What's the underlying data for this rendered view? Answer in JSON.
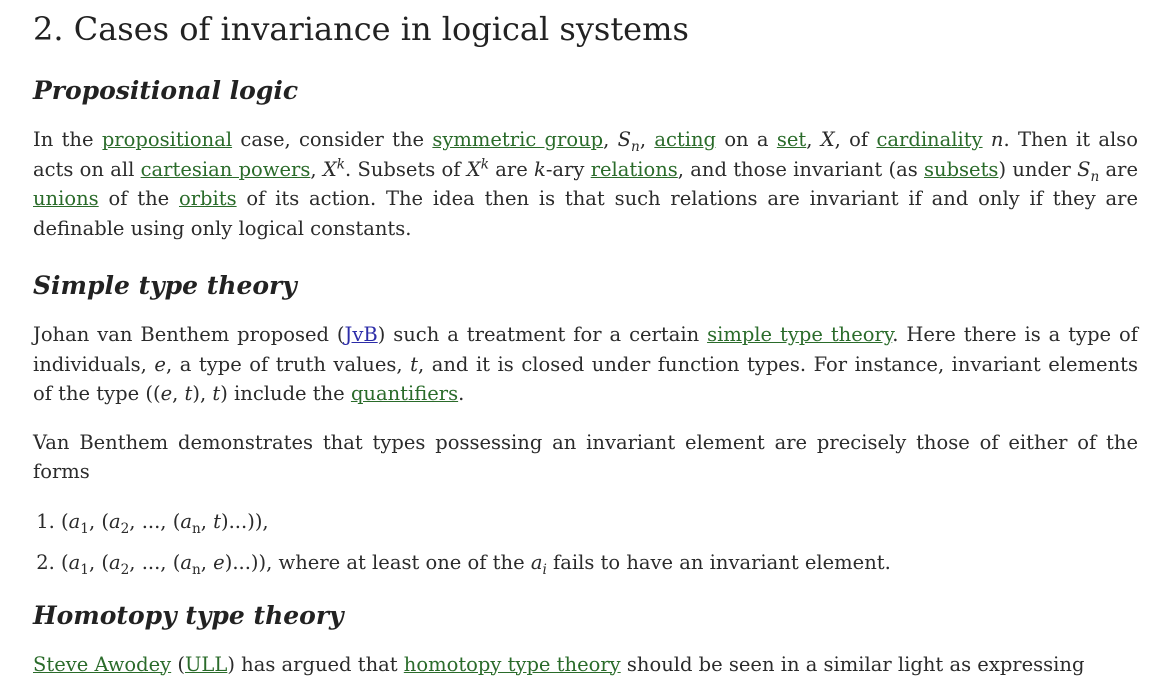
{
  "section": {
    "title": "2. Cases of invariance in logical systems"
  },
  "propositional": {
    "heading": "Propositional logic",
    "t1": "In the ",
    "l_propositional": "propositional",
    "t2": " case, consider the ",
    "l_symmetric_group": "symmetric group",
    "t3": ", ",
    "S": "S",
    "n": "n",
    "t4": ", ",
    "l_acting": "acting",
    "t5": " on a ",
    "l_set": "set",
    "t6": ", ",
    "X": "X",
    "t7": ", of ",
    "l_cardinality": "cardinality",
    "t8": " ",
    "n2": "n",
    "t9": ". Then it also acts on all ",
    "l_cartesian_powers": "cartesian powers",
    "t10": ", ",
    "k": "k",
    "t11": ". Subsets of ",
    "t12": " are ",
    "t13": "-ary ",
    "l_relations": "relations",
    "t14": ", and those invariant (as ",
    "l_subsets": "subsets",
    "t15": ") under ",
    "t16": " are ",
    "l_unions": "unions",
    "t17": " of the ",
    "l_orbits": "orbits",
    "t18": " of its action. The idea then is that such relations are invariant if and only if they are definable using only logical constants."
  },
  "simple_type": {
    "heading": "Simple type theory",
    "t1": "Johan van Benthem proposed (",
    "l_jvb": "JvB",
    "t2": ") such a treatment for a certain ",
    "l_simple_type_theory": "simple type theory",
    "t3": ". Here there is a type of individuals, ",
    "e": "e",
    "t4": ", a type of truth values, ",
    "t": "t",
    "t5": ", and it is closed under function types. For instance, invariant elements of the type ",
    "type_expr_open": "((",
    "comma": ", ",
    "paren_close": ")",
    "type_expr_close": ")",
    "t6": " include the ",
    "l_quantifiers": "quantifiers",
    "t7": ".",
    "para2": "Van Benthem demonstrates that types possessing an invariant element are precisely those of either of the forms",
    "forms": [
      {
        "prefix": "(",
        "a": "a",
        "s1": "1",
        "s2": "2",
        "dots": "...",
        "end_var": "t",
        "suffix": "...)),",
        "tail": ""
      },
      {
        "prefix": "(",
        "a": "a",
        "s1": "1",
        "s2": "2",
        "dots": "...",
        "end_var": "e",
        "suffix": "...)),",
        "tail": " where at least one of the ",
        "ai": "a",
        "i": "i",
        "tail2": " fails to have an invariant element."
      }
    ]
  },
  "homotopy": {
    "heading": "Homotopy type theory",
    "l_steve": "Steve Awodey",
    "t1": " (",
    "l_ull": "ULL",
    "t2": ") has argued that ",
    "l_hott": "homotopy type theory",
    "t3": " should be seen in a similar light as expressing"
  },
  "colors": {
    "wiki_link": "#2a6b2a",
    "external_link": "#2c2ca8",
    "text": "#2b2b2b"
  }
}
